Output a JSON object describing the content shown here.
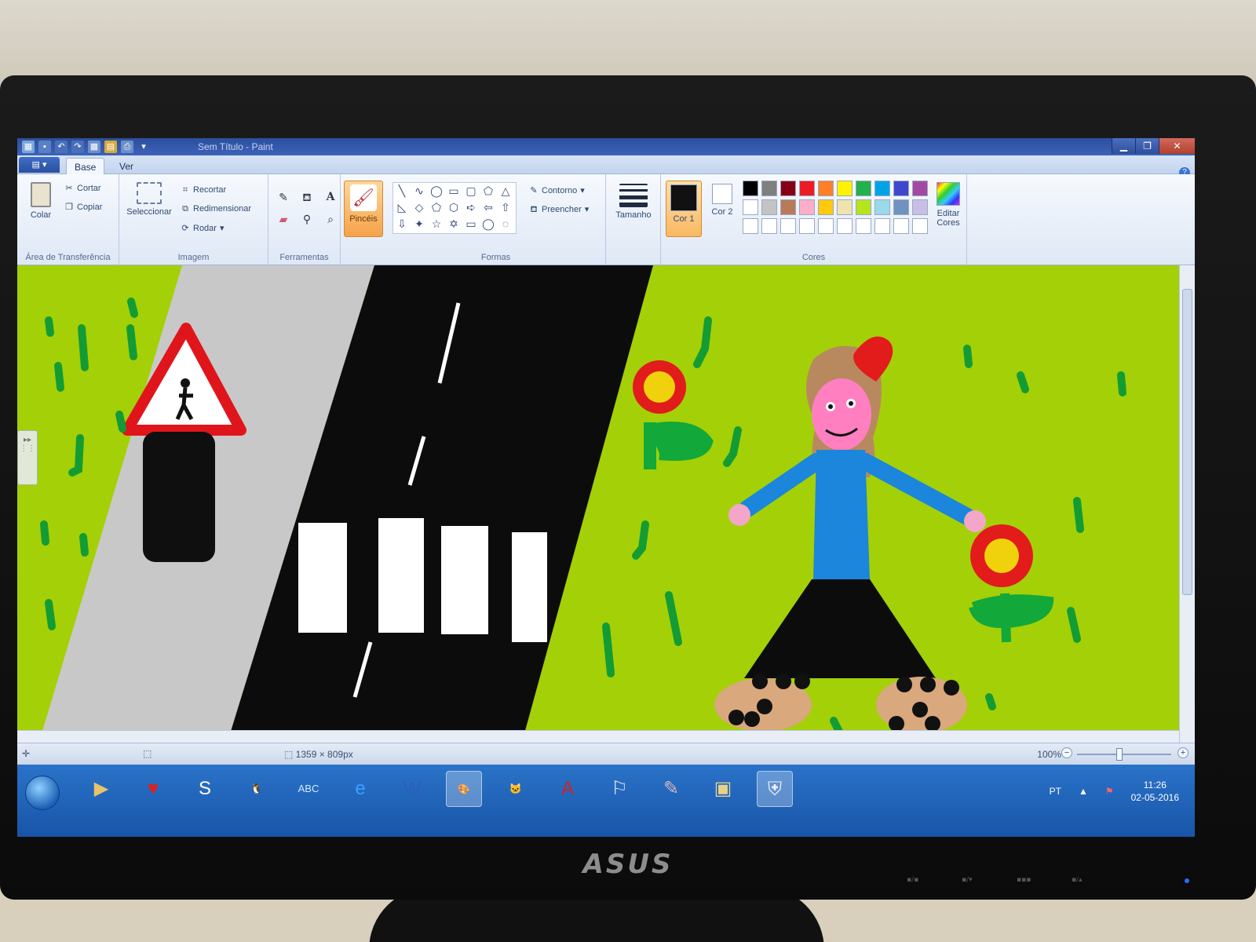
{
  "window": {
    "title": "Sem Título - Paint",
    "minimize_icon": "minimize-icon",
    "maximize_icon": "restore-icon",
    "close_icon": "close-icon"
  },
  "ribbon": {
    "app_menu": "▤ ▾",
    "tabs": [
      {
        "label": "Base",
        "active": true
      },
      {
        "label": "Ver",
        "active": false
      }
    ],
    "clipboard": {
      "paste_label": "Colar",
      "cut_label": "Cortar",
      "copy_label": "Copiar",
      "group_label": "Área de Transferência"
    },
    "image": {
      "select_label": "Seleccionar",
      "crop_label": "Recortar",
      "resize_label": "Redimensionar",
      "rotate_label": "Rodar",
      "group_label": "Imagem"
    },
    "tools": {
      "group_label": "Ferramentas",
      "items": [
        "pencil-icon",
        "fill-bucket-icon",
        "text-icon",
        "eraser-icon",
        "color-picker-icon",
        "magnifier-icon"
      ]
    },
    "brushes": {
      "label": "Pincéis"
    },
    "shapes": {
      "group_label": "Formas",
      "outline_label": "Contorno",
      "fill_label": "Preencher",
      "glyphs": [
        "╲",
        "∿",
        "◯",
        "▭",
        "▢",
        "⬠",
        "△",
        "◺",
        "◇",
        "⬠",
        "⬡",
        "➪",
        "⇦",
        "⇧",
        "⇩",
        "✦",
        "☆",
        "✡",
        "▭",
        "◯",
        "◌"
      ]
    },
    "size": {
      "label": "Tamanho"
    },
    "colors": {
      "color1_label": "Cor 1",
      "color2_label": "Cor 2",
      "edit_label": "Editar Cores",
      "group_label": "Cores",
      "color1": "#111111",
      "color2": "#ffffff",
      "palette_row1": [
        "#000000",
        "#7f7f7f",
        "#880015",
        "#ed1c24",
        "#ff7f27",
        "#fff200",
        "#22b14c",
        "#00a2e8",
        "#3f48cc",
        "#a349a4"
      ],
      "palette_row2": [
        "#ffffff",
        "#c3c3c3",
        "#b97a57",
        "#ffaec9",
        "#ffc90e",
        "#efe4b0",
        "#b5e61d",
        "#99d9ea",
        "#7092be",
        "#c8bfe7"
      ]
    }
  },
  "status": {
    "dimensions": "1359 × 809px",
    "zoom": "100%"
  },
  "taskbar": {
    "apps": [
      {
        "name": "media-player-icon",
        "glyph": "▶",
        "active": false
      },
      {
        "name": "heart-icon",
        "glyph": "♥",
        "active": false
      },
      {
        "name": "app-s-icon",
        "glyph": "S",
        "active": false
      },
      {
        "name": "penguin-icon",
        "glyph": "🐧",
        "active": false
      },
      {
        "name": "abc-icon",
        "glyph": "ABC",
        "active": false
      },
      {
        "name": "internet-explorer-icon",
        "glyph": "e",
        "active": false
      },
      {
        "name": "word-icon",
        "glyph": "W",
        "active": false
      },
      {
        "name": "paint-icon",
        "glyph": "🎨",
        "active": true
      },
      {
        "name": "cat-icon",
        "glyph": "🐱",
        "active": false
      },
      {
        "name": "acrobat-icon",
        "glyph": "A",
        "active": false
      },
      {
        "name": "pdf-reader-icon",
        "glyph": "⚐",
        "active": false
      },
      {
        "name": "notepad-icon",
        "glyph": "✎",
        "active": false
      },
      {
        "name": "folder-icon",
        "glyph": "▣",
        "active": false
      },
      {
        "name": "security-shield-icon",
        "glyph": "⛨",
        "active": true
      }
    ],
    "language": "PT",
    "time": "11:26",
    "date": "02-05-2016"
  },
  "monitor": {
    "brand": "ASUS"
  }
}
